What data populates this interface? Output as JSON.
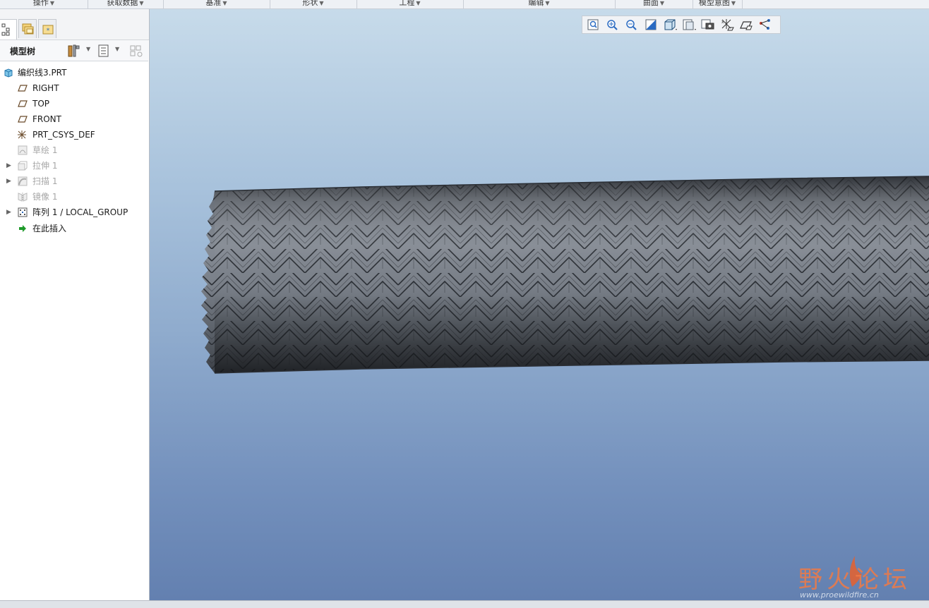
{
  "ribbon": {
    "groups": [
      {
        "label": "操作"
      },
      {
        "label": "获取数据"
      },
      {
        "label": "基准"
      },
      {
        "label": "形状"
      },
      {
        "label": "工程"
      },
      {
        "label": "编辑"
      },
      {
        "label": "曲面"
      },
      {
        "label": "模型意图"
      }
    ]
  },
  "model_tree": {
    "title": "模型树",
    "items": [
      {
        "label": "编织线3.PRT",
        "icon": "part-icon",
        "dim": false,
        "expandable": false
      },
      {
        "label": "RIGHT",
        "icon": "datum-plane-icon",
        "dim": false,
        "expandable": false
      },
      {
        "label": "TOP",
        "icon": "datum-plane-icon",
        "dim": false,
        "expandable": false
      },
      {
        "label": "FRONT",
        "icon": "datum-plane-icon",
        "dim": false,
        "expandable": false
      },
      {
        "label": "PRT_CSYS_DEF",
        "icon": "coordinate-system-icon",
        "dim": false,
        "expandable": false
      },
      {
        "label": "草绘 1",
        "icon": "sketch-icon",
        "dim": true,
        "expandable": false
      },
      {
        "label": "拉伸 1",
        "icon": "extrude-icon",
        "dim": true,
        "expandable": true
      },
      {
        "label": "扫描 1",
        "icon": "sweep-icon",
        "dim": true,
        "expandable": true
      },
      {
        "label": "镜像 1",
        "icon": "mirror-icon",
        "dim": true,
        "expandable": false
      },
      {
        "label": "阵列 1 / LOCAL_GROUP",
        "icon": "pattern-icon",
        "dim": false,
        "expandable": true
      },
      {
        "label": "在此插入",
        "icon": "insert-here-arrow-icon",
        "dim": false,
        "expandable": false
      }
    ]
  },
  "view_toolbar": {
    "buttons": [
      {
        "icon": "refit-icon"
      },
      {
        "icon": "zoom-in-icon"
      },
      {
        "icon": "zoom-out-icon"
      },
      {
        "icon": "repaint-icon"
      },
      {
        "icon": "display-style-icon"
      },
      {
        "icon": "saved-orientations-icon"
      },
      {
        "icon": "view-manager-icon"
      },
      {
        "icon": "datum-display-icon"
      },
      {
        "icon": "spin-center-icon"
      },
      {
        "icon": "annotation-display-icon"
      }
    ]
  },
  "watermark": {
    "brand": "野火论坛",
    "url": "www.proewildfire.cn"
  },
  "colors": {
    "accent_flame": "#e8602c",
    "viewport_top": "#c7dbea",
    "viewport_bottom": "#6380b0",
    "braid": "#6f7680"
  }
}
